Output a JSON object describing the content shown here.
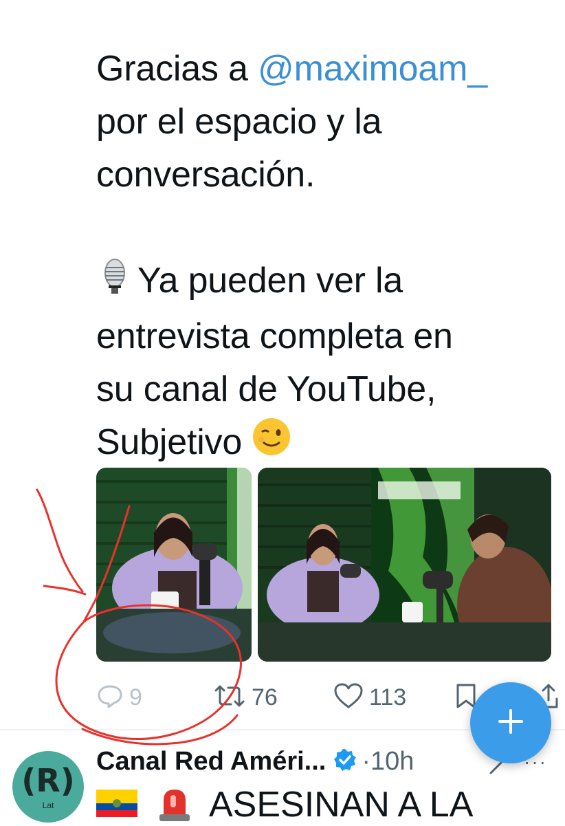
{
  "tweet": {
    "line1_prefix": "Gracias a ",
    "mention": "@maximoam_",
    "line2": "por el espacio y la",
    "line3": "conversación.",
    "line4": "Ya pueden ver la",
    "line5": "entrevista completa en",
    "line6": "su canal de YouTube,",
    "line7": "Subjetivo",
    "emoji_mic": "studio-microphone-emoji",
    "emoji_wink": "winking-face-emoji"
  },
  "actions": {
    "replies": "9",
    "retweets": "76",
    "likes": "113"
  },
  "next_tweet": {
    "name": "Canal Red Améri...",
    "time": "·10h",
    "more": "···",
    "avatar_text": "(R)",
    "avatar_sub": "Lat",
    "text": "ASESINAN A LA",
    "flag": "ecuador-flag-emoji",
    "siren": "police-light-emoji"
  },
  "colors": {
    "mention": "#3b8fd6",
    "fab": "#3b9cea",
    "verified": "#1d9bf0",
    "annotation": "#e8322b",
    "avatar": "#4aab9c"
  }
}
